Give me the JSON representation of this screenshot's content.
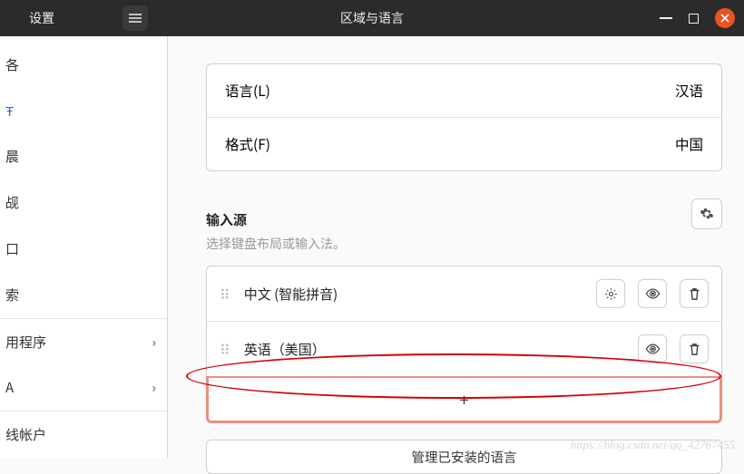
{
  "header": {
    "app_name": "设置",
    "window_title": "区域与语言"
  },
  "sidebar": {
    "items": [
      {
        "label": "各"
      },
      {
        "label": "Ŧ",
        "selected": true
      },
      {
        "label": "晨"
      },
      {
        "label": "觇"
      },
      {
        "label": "口"
      },
      {
        "label": "索"
      },
      {
        "label": "用程序",
        "chevron": true
      },
      {
        "label": "A",
        "chevron": true
      },
      {
        "label": "线帐户"
      }
    ]
  },
  "locale": {
    "language_label": "语言(L)",
    "language_value": "汉语",
    "formats_label": "格式(F)",
    "formats_value": "中国"
  },
  "input_sources": {
    "title": "输入源",
    "subtitle": "选择键盘布局或输入法。",
    "items": [
      {
        "name": "中文 (智能拼音)",
        "has_settings": true
      },
      {
        "name": "英语（美国）",
        "has_settings": false
      }
    ],
    "add_label": "+",
    "manage_label": "管理已安装的语言"
  },
  "watermark": "https://blog.csdn.net/qq_42767455"
}
